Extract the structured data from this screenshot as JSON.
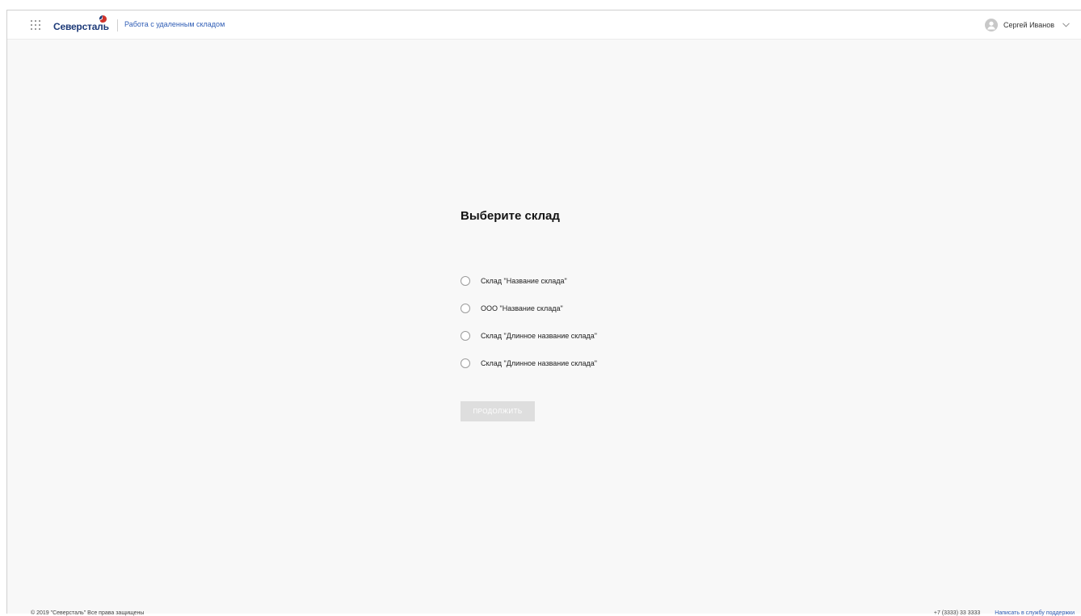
{
  "header": {
    "brand": "Северсталь",
    "subtitle": "Работа с удаленным складом",
    "user_name": "Сергей Иванов",
    "colors": {
      "brand": "#1d3a78",
      "brand_mark": "#d0342c",
      "link": "#2f5db5"
    }
  },
  "icons": [
    "apps-grid-icon",
    "user-avatar-icon",
    "chevron-down-icon"
  ],
  "main": {
    "title": "Выберите склад",
    "options": [
      {
        "label": "Склад \"Название склада\"",
        "selected": false
      },
      {
        "label": "ООО \"Название склада\"",
        "selected": false
      },
      {
        "label": "Склад \"Длинное название склада\"",
        "selected": false
      },
      {
        "label": "Склад \"Длинное название склада\"",
        "selected": false
      }
    ],
    "continue_label": "ПРОДОЛЖИТЬ",
    "continue_disabled": true
  },
  "footer": {
    "copyright": "© 2019 \"Северсталь\" Все права защищены",
    "phone": "+7 (3333) 33 3333",
    "support_link": "Написать в службу поддержки"
  }
}
